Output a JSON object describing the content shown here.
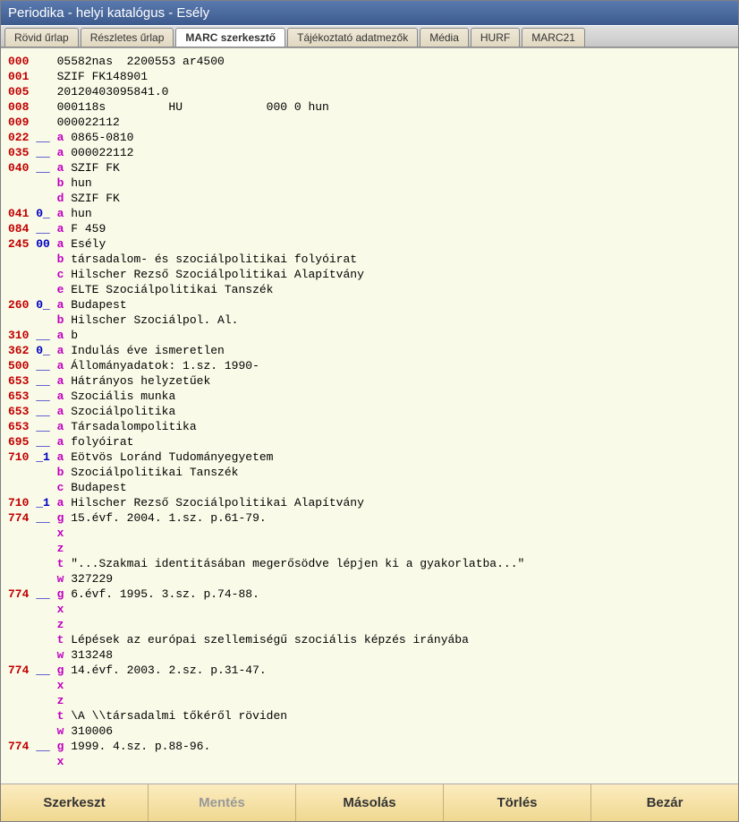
{
  "title": "Periodika - helyi katalógus - Esély",
  "tabs": [
    {
      "label": "Rövid űrlap",
      "active": false
    },
    {
      "label": "Részletes űrlap",
      "active": false
    },
    {
      "label": "MARC szerkesztő",
      "active": true
    },
    {
      "label": "Tájékoztató adatmezők",
      "active": false
    },
    {
      "label": "Média",
      "active": false
    },
    {
      "label": "HURF",
      "active": false
    },
    {
      "label": "MARC21",
      "active": false
    }
  ],
  "marc": [
    {
      "tag": "000",
      "ind": "",
      "sub": "",
      "val": "05582nas  2200553 ar4500"
    },
    {
      "tag": "001",
      "ind": "",
      "sub": "",
      "val": "SZIF FK148901"
    },
    {
      "tag": "005",
      "ind": "",
      "sub": "",
      "val": "20120403095841.0"
    },
    {
      "tag": "008",
      "ind": "",
      "sub": "",
      "val": "000118s         HU            000 0 hun"
    },
    {
      "tag": "009",
      "ind": "",
      "sub": "",
      "val": "000022112"
    },
    {
      "tag": "022",
      "ind": "__",
      "sub": "a",
      "val": "0865-0810"
    },
    {
      "tag": "035",
      "ind": "__",
      "sub": "a",
      "val": "000022112"
    },
    {
      "tag": "040",
      "ind": "__",
      "sub": "a",
      "val": "SZIF FK"
    },
    {
      "tag": "",
      "ind": "",
      "sub": "b",
      "val": "hun"
    },
    {
      "tag": "",
      "ind": "",
      "sub": "d",
      "val": "SZIF FK"
    },
    {
      "tag": "041",
      "ind": "0_",
      "sub": "a",
      "val": "hun"
    },
    {
      "tag": "084",
      "ind": "__",
      "sub": "a",
      "val": "F 459"
    },
    {
      "tag": "245",
      "ind": "00",
      "sub": "a",
      "val": "Esély"
    },
    {
      "tag": "",
      "ind": "",
      "sub": "b",
      "val": "társadalom- és szociálpolitikai folyóirat"
    },
    {
      "tag": "",
      "ind": "",
      "sub": "c",
      "val": "Hilscher Rezső Szociálpolitikai Alapítvány"
    },
    {
      "tag": "",
      "ind": "",
      "sub": "e",
      "val": "ELTE Szociálpolitikai Tanszék"
    },
    {
      "tag": "260",
      "ind": "0_",
      "sub": "a",
      "val": "Budapest"
    },
    {
      "tag": "",
      "ind": "",
      "sub": "b",
      "val": "Hilscher Szociálpol. Al."
    },
    {
      "tag": "310",
      "ind": "__",
      "sub": "a",
      "val": "b"
    },
    {
      "tag": "362",
      "ind": "0_",
      "sub": "a",
      "val": "Indulás éve ismeretlen"
    },
    {
      "tag": "500",
      "ind": "__",
      "sub": "a",
      "val": "Állományadatok: 1.sz. 1990-"
    },
    {
      "tag": "653",
      "ind": "__",
      "sub": "a",
      "val": "Hátrányos helyzetűek"
    },
    {
      "tag": "653",
      "ind": "__",
      "sub": "a",
      "val": "Szociális munka"
    },
    {
      "tag": "653",
      "ind": "__",
      "sub": "a",
      "val": "Szociálpolitika"
    },
    {
      "tag": "653",
      "ind": "__",
      "sub": "a",
      "val": "Társadalompolitika"
    },
    {
      "tag": "695",
      "ind": "__",
      "sub": "a",
      "val": "folyóirat"
    },
    {
      "tag": "710",
      "ind": "_1",
      "sub": "a",
      "val": "Eötvös Loránd Tudományegyetem"
    },
    {
      "tag": "",
      "ind": "",
      "sub": "b",
      "val": "Szociálpolitikai Tanszék"
    },
    {
      "tag": "",
      "ind": "",
      "sub": "c",
      "val": "Budapest"
    },
    {
      "tag": "710",
      "ind": "_1",
      "sub": "a",
      "val": "Hilscher Rezső Szociálpolitikai Alapítvány"
    },
    {
      "tag": "774",
      "ind": "__",
      "sub": "g",
      "val": "15.évf. 2004. 1.sz. p.61-79."
    },
    {
      "tag": "",
      "ind": "",
      "sub": "x",
      "val": ""
    },
    {
      "tag": "",
      "ind": "",
      "sub": "z",
      "val": ""
    },
    {
      "tag": "",
      "ind": "",
      "sub": "t",
      "val": "\"...Szakmai identitásában megerősödve lépjen ki a gyakorlatba...\""
    },
    {
      "tag": "",
      "ind": "",
      "sub": "w",
      "val": "327229"
    },
    {
      "tag": "774",
      "ind": "__",
      "sub": "g",
      "val": "6.évf. 1995. 3.sz. p.74-88."
    },
    {
      "tag": "",
      "ind": "",
      "sub": "x",
      "val": ""
    },
    {
      "tag": "",
      "ind": "",
      "sub": "z",
      "val": ""
    },
    {
      "tag": "",
      "ind": "",
      "sub": "t",
      "val": "Lépések az európai szellemiségű szociális képzés irányába"
    },
    {
      "tag": "",
      "ind": "",
      "sub": "w",
      "val": "313248"
    },
    {
      "tag": "774",
      "ind": "__",
      "sub": "g",
      "val": "14.évf. 2003. 2.sz. p.31-47."
    },
    {
      "tag": "",
      "ind": "",
      "sub": "x",
      "val": ""
    },
    {
      "tag": "",
      "ind": "",
      "sub": "z",
      "val": ""
    },
    {
      "tag": "",
      "ind": "",
      "sub": "t",
      "val": "\\A \\\\társadalmi tőkéről röviden"
    },
    {
      "tag": "",
      "ind": "",
      "sub": "w",
      "val": "310006"
    },
    {
      "tag": "774",
      "ind": "__",
      "sub": "g",
      "val": "1999. 4.sz. p.88-96."
    },
    {
      "tag": "",
      "ind": "",
      "sub": "x",
      "val": ""
    }
  ],
  "buttons": {
    "edit": "Szerkeszt",
    "save": "Mentés",
    "copy": "Másolás",
    "delete": "Törlés",
    "close": "Bezár"
  }
}
